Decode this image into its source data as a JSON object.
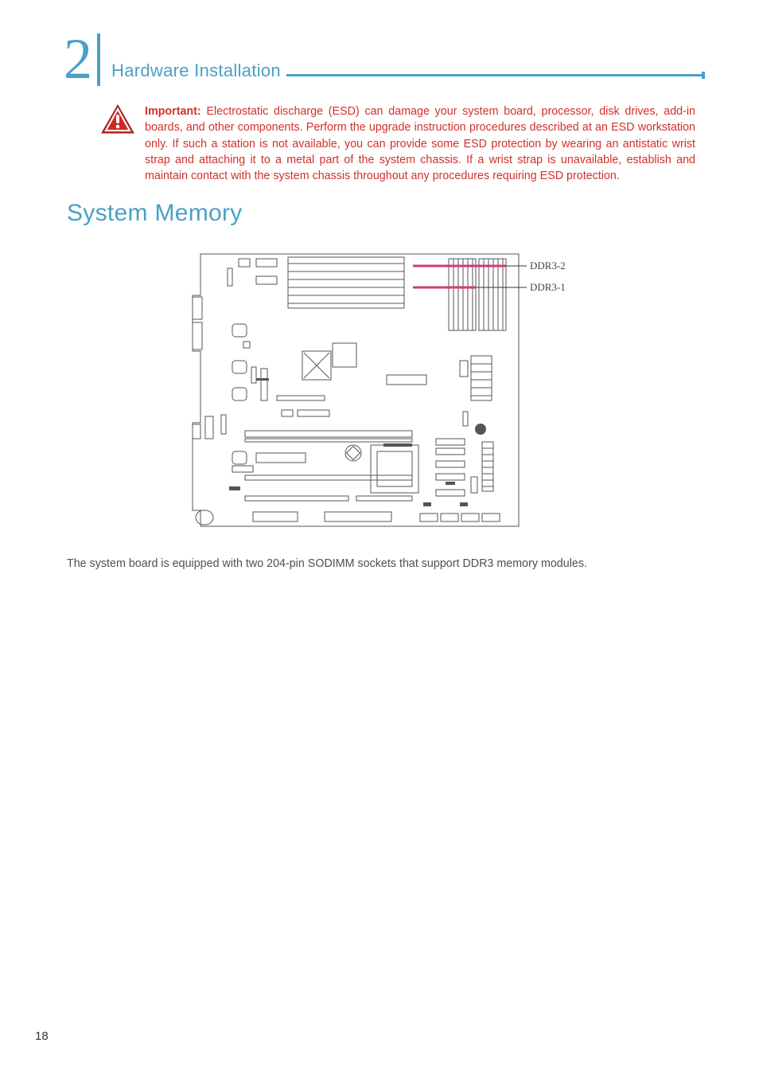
{
  "chapter": {
    "number": "2",
    "title": "Hardware Installation"
  },
  "important": {
    "label": "Important:",
    "text": "Electrostatic discharge (ESD) can damage your system board, processor, disk drives, add-in boards, and other components. Perform the upgrade instruction procedures described at an ESD workstation only. If such a station is not available, you can provide some ESD protection by wearing an antistatic wrist strap and attaching it to a metal part of the system chassis. If a wrist strap is unavailable, establish and maintain contact with the system chassis throughout any procedures requiring ESD protection."
  },
  "section": {
    "title": "System Memory"
  },
  "diagram": {
    "labels": {
      "ddr3_2": "DDR3-2",
      "ddr3_1": "DDR3-1"
    }
  },
  "body": {
    "paragraph": "The system board is equipped with two 204-pin SODIMM sockets that support DDR3 memory modules."
  },
  "page_number": "18"
}
